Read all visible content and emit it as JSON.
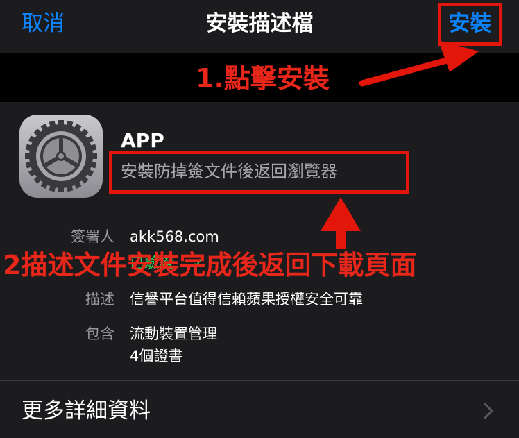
{
  "navbar": {
    "cancel_label": "取消",
    "title": "安裝描述檔",
    "install_label": "安裝"
  },
  "annotations": {
    "step1": "1.點擊安裝",
    "step2": "2描述文件安裝完成後返回下載頁面"
  },
  "profile": {
    "name": "APP",
    "description": "安裝防掉簽文件後返回瀏覽器",
    "icon": "settings-gear-icon"
  },
  "details": {
    "signed_by_label": "簽署人",
    "signed_by_value": "akk568.com",
    "verified_text": "已驗證",
    "verified_mark": "✓",
    "description_label": "描述",
    "description_value": "信譽平台值得信賴蘋果授權安全可靠",
    "contains_label": "包含",
    "contains_values": [
      "流動裝置管理",
      "4個證書"
    ]
  },
  "more_details_label": "更多詳細資料",
  "colors": {
    "background": "#1c1c1e",
    "accent_blue": "#0a84ff",
    "annotation_red": "#e2160b",
    "verified_green": "#30d158"
  }
}
